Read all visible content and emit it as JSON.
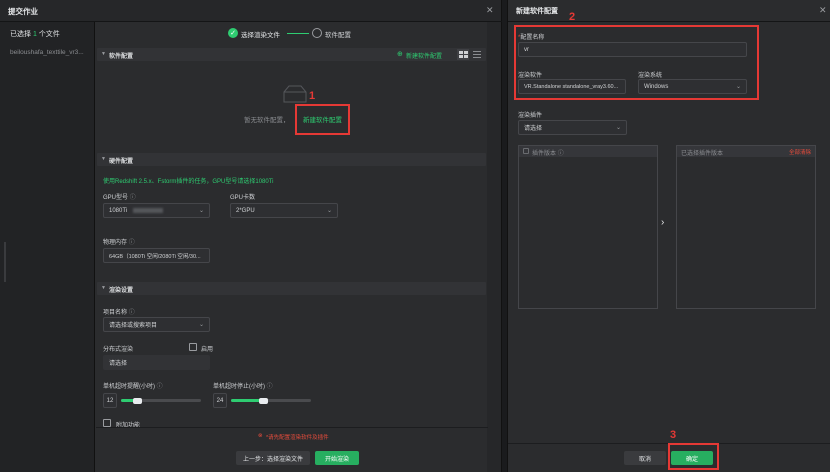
{
  "left_dialog": {
    "title": "提交作业",
    "selected_prefix": "已选择 ",
    "selected_count": "1",
    "selected_suffix": " 个文件",
    "file_name": "beiloushafa_texttile_vr3...",
    "steps": [
      "选择渲染文件",
      "软件配置"
    ],
    "software_section": "软件配置",
    "new_config_link": "新建软件配置",
    "empty_text": "暂无软件配置，",
    "empty_link": "新建软件配置",
    "hardware_section": "硬件配置",
    "hardware_tip": "使用Redshift 2.5.x、Fstorm插件的任务，GPU型号请选择1080Ti",
    "gpu_model_label": "GPU型号",
    "gpu_model_value": "1080Ti",
    "gpu_count_label": "GPU卡数",
    "gpu_count_value": "2*GPU",
    "memory_label": "物理内存",
    "memory_value": "64GB（1080Ti 空闲/2080Ti 空闲/30...",
    "render_section": "渲染设置",
    "project_label": "项目名称",
    "project_value": "请选择或搜索项目",
    "distributed_label": "分布式渲染",
    "distributed_enable": "启用",
    "distributed_value": "请选择",
    "start_label": "单机超时提醒(小时)",
    "start_value": "12",
    "start_fraction": 0.2,
    "stop_label": "单机超时停止(小时)",
    "stop_value": "24",
    "stop_fraction": 0.4,
    "extra_label": "附加功能",
    "error_text": "*请先配置渲染软件及插件",
    "prev_button": "上一步：选择渲染文件",
    "start_button": "开始渲染"
  },
  "right_panel": {
    "title": "新建软件配置",
    "config_name_label": "配置名称",
    "config_name_value": "vr",
    "software_label": "渲染软件",
    "software_value": "VR.Standalone standalone_vray3.60...",
    "os_label": "渲染系统",
    "os_value": "Windows",
    "plugin_label": "渲染插件",
    "plugin_value": "请选择",
    "plugin_version_header": "插件版本",
    "selected_header": "已选择插件版本",
    "clear_link": "全部清除",
    "cancel_button": "取消",
    "confirm_button": "确定"
  },
  "annotations": [
    "1",
    "2",
    "3"
  ],
  "colors": {
    "accent": "#2ecc71",
    "highlight": "#e53935",
    "panel": "#2b2c2e",
    "background": "#1a1b1d"
  }
}
